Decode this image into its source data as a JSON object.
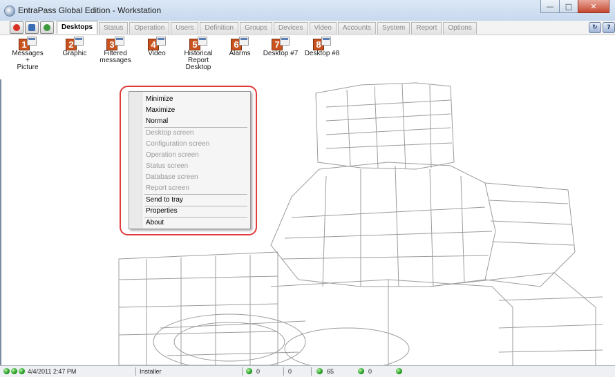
{
  "window": {
    "title": "EntraPass Global Edition - Workstation",
    "buttons": [
      "minimize",
      "maximize",
      "close"
    ]
  },
  "quick_buttons": [
    {
      "name": "power-icon",
      "color": "#d93025"
    },
    {
      "name": "monitor-icon",
      "color": "#3a6db4"
    },
    {
      "name": "refresh-icon",
      "color": "#3c9a3c"
    }
  ],
  "tabs": [
    "Desktops",
    "Status",
    "Operation",
    "Users",
    "Definition",
    "Groups",
    "Devices",
    "Video",
    "Accounts",
    "System",
    "Report",
    "Options"
  ],
  "active_tab": "Desktops",
  "desktops": [
    {
      "num": "1",
      "label": "Messages +\nPicture"
    },
    {
      "num": "2",
      "label": "Graphic"
    },
    {
      "num": "3",
      "label": "Filtered\nmessages"
    },
    {
      "num": "4",
      "label": "Video"
    },
    {
      "num": "5",
      "label": "Historical\nReport\nDesktop"
    },
    {
      "num": "6",
      "label": "Alarms"
    },
    {
      "num": "7",
      "label": "Desktop #7"
    },
    {
      "num": "8",
      "label": "Desktop #8"
    }
  ],
  "context_menu": {
    "items": [
      {
        "label": "Minimize",
        "enabled": true
      },
      {
        "label": "Maximize",
        "enabled": true
      },
      {
        "label": "Normal",
        "enabled": true
      },
      {
        "label": "Desktop screen",
        "enabled": false
      },
      {
        "label": "Configuration screen",
        "enabled": false
      },
      {
        "label": "Operation screen",
        "enabled": false
      },
      {
        "label": "Status screen",
        "enabled": false
      },
      {
        "label": "Database screen",
        "enabled": false
      },
      {
        "label": "Report screen",
        "enabled": false
      },
      {
        "label": "Send to tray",
        "enabled": true
      },
      {
        "label": "Properties",
        "enabled": true
      },
      {
        "label": "About",
        "enabled": true
      }
    ]
  },
  "status_bar": {
    "datetime": "4/4/2011 2:47 PM",
    "user": "Installer",
    "count_a": "0",
    "count_b": "0",
    "count_c": "65",
    "count_d": "0"
  }
}
